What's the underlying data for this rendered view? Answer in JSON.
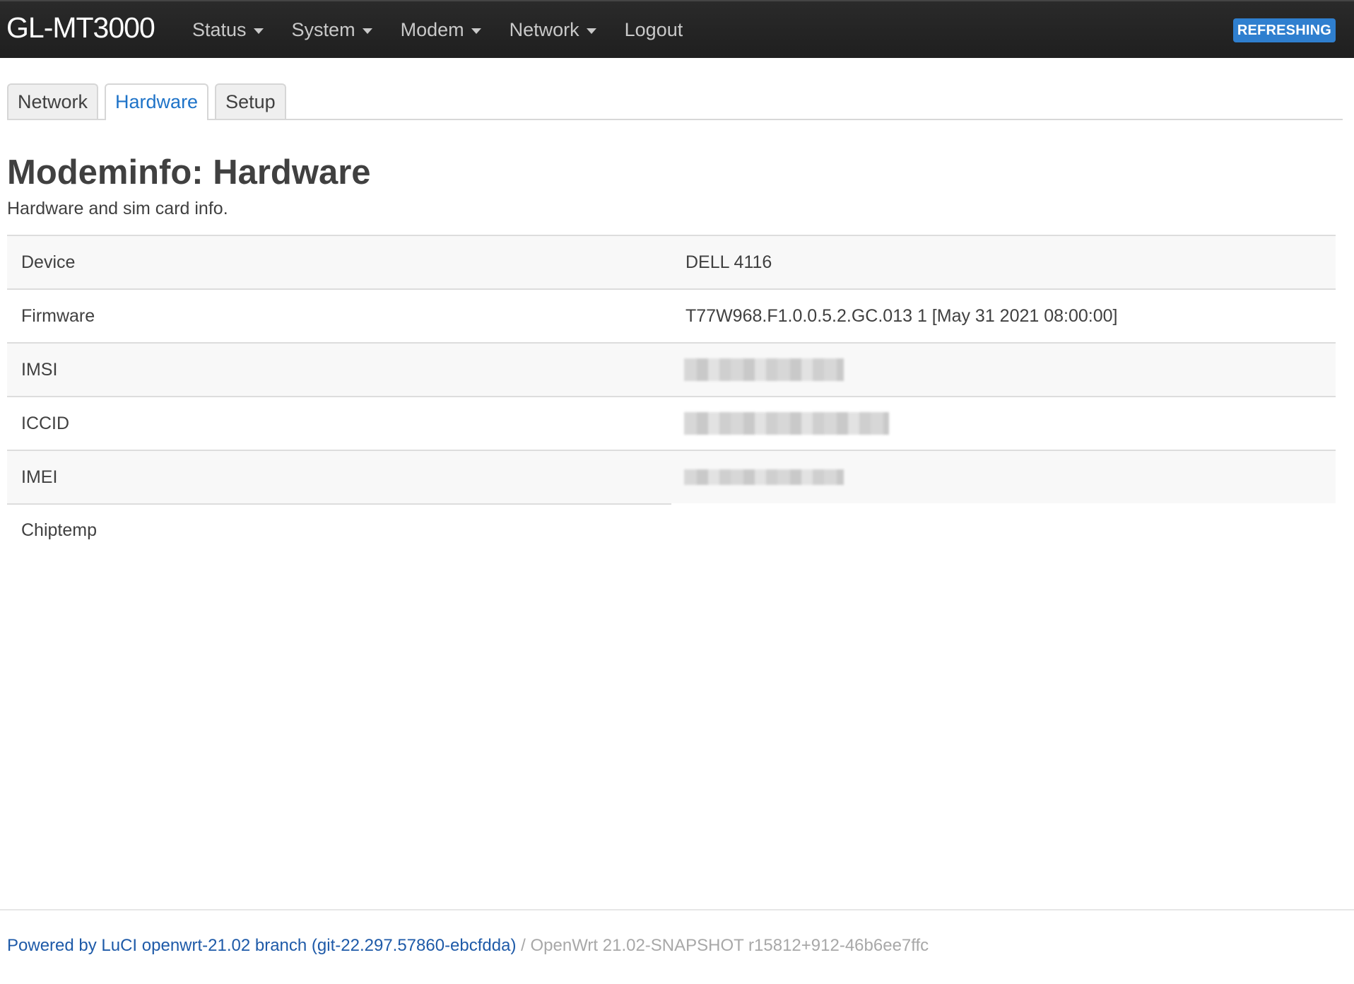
{
  "navbar": {
    "brand": "GL-MT3000",
    "menu": [
      {
        "label": "Status",
        "has_dropdown": true
      },
      {
        "label": "System",
        "has_dropdown": true
      },
      {
        "label": "Modem",
        "has_dropdown": true
      },
      {
        "label": "Network",
        "has_dropdown": true
      },
      {
        "label": "Logout",
        "has_dropdown": false
      }
    ],
    "badge": "REFRESHING",
    "badge_color": "#2f7fcf"
  },
  "tabs": [
    {
      "label": "Network",
      "active": false
    },
    {
      "label": "Hardware",
      "active": true
    },
    {
      "label": "Setup",
      "active": false
    }
  ],
  "page": {
    "title": "Modeminfo: Hardware",
    "description": "Hardware and sim card info."
  },
  "table": {
    "rows": [
      {
        "label": "Device",
        "value": "DELL 4116"
      },
      {
        "label": "Firmware",
        "value": "T77W968.F1.0.0.5.2.GC.013 1 [May 31 2021 08:00:00]"
      },
      {
        "label": "IMSI",
        "value": ""
      },
      {
        "label": "ICCID",
        "value": ""
      },
      {
        "label": "IMEI",
        "value": ""
      },
      {
        "label": "Chiptemp",
        "value": ""
      }
    ]
  },
  "footer": {
    "link_text": "Powered by LuCI openwrt-21.02 branch (git-22.297.57860-ebcfdda)",
    "separator": " / ",
    "version_text": "OpenWrt 21.02-SNAPSHOT r15812+912-46b6ee7ffc"
  },
  "colors": {
    "navbar_bg": "#222222",
    "active_tab": "#1e73c8",
    "link": "#1e5aa8"
  }
}
